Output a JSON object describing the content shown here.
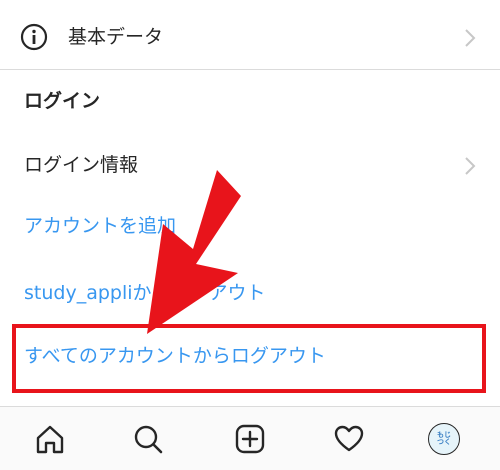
{
  "settings": {
    "basic_data_label": "基本データ",
    "login_section_title": "ログイン",
    "login_info_label": "ログイン情報",
    "add_account_label": "アカウントを追加",
    "logout_user_label": "study_appliからログアウト",
    "logout_all_label": "すべてのアカウントからログアウト"
  },
  "avatar_text": "もじつく",
  "colors": {
    "link": "#3897f0",
    "highlight": "#e8141b",
    "text": "#262626"
  }
}
